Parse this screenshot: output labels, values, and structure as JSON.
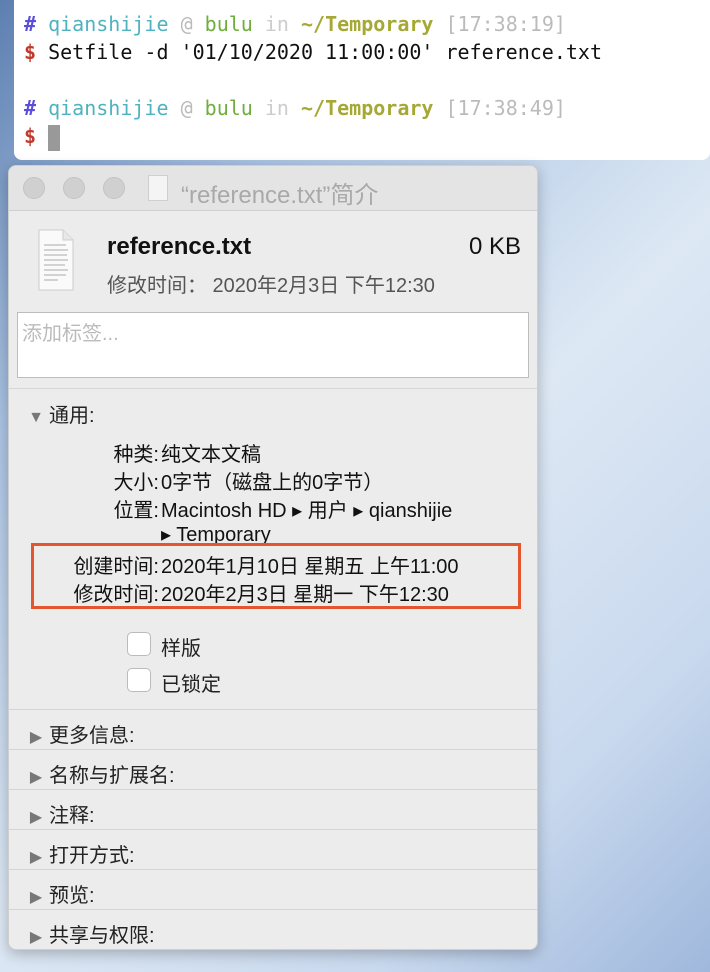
{
  "terminal": {
    "lines": [
      {
        "hash": "#",
        "user": "qianshijie",
        "at": "@",
        "host": "bulu",
        "in": "in",
        "dir": "~/Temporary",
        "time": "[17:38:19]"
      },
      {
        "hash": "#",
        "user": "qianshijie",
        "at": "@",
        "host": "bulu",
        "in": "in",
        "dir": "~/Temporary",
        "time": "[17:38:49]"
      }
    ],
    "prompt": "$",
    "command": "Setfile -d '01/10/2020 11:00:00' reference.txt"
  },
  "info": {
    "title": "“reference.txt”简介",
    "file_name": "reference.txt",
    "file_size": "0 KB",
    "modified_summary": "修改时间： 2020年2月3日 下午12:30",
    "tags_placeholder": "添加标签...",
    "general": {
      "label": "通用:",
      "kind_label": "种类:",
      "kind": "纯文本文稿",
      "size_label": "大小:",
      "size": "0字节（磁盘上的0字节）",
      "where_label": "位置:",
      "where": "Macintosh HD ▸ 用户 ▸ qianshijie",
      "where2": "▸ Temporary",
      "created_label": "创建时间:",
      "created": "2020年1月10日 星期五 上午11:00",
      "modified_label": "修改时间:",
      "modified": "2020年2月3日 星期一 下午12:30",
      "stationery": "样版",
      "locked": "已锁定"
    },
    "sections": [
      "更多信息:",
      "名称与扩展名:",
      "注释:",
      "打开方式:",
      "预览:",
      "共享与权限:"
    ]
  },
  "colors": {
    "highlight": "#e4572e"
  }
}
